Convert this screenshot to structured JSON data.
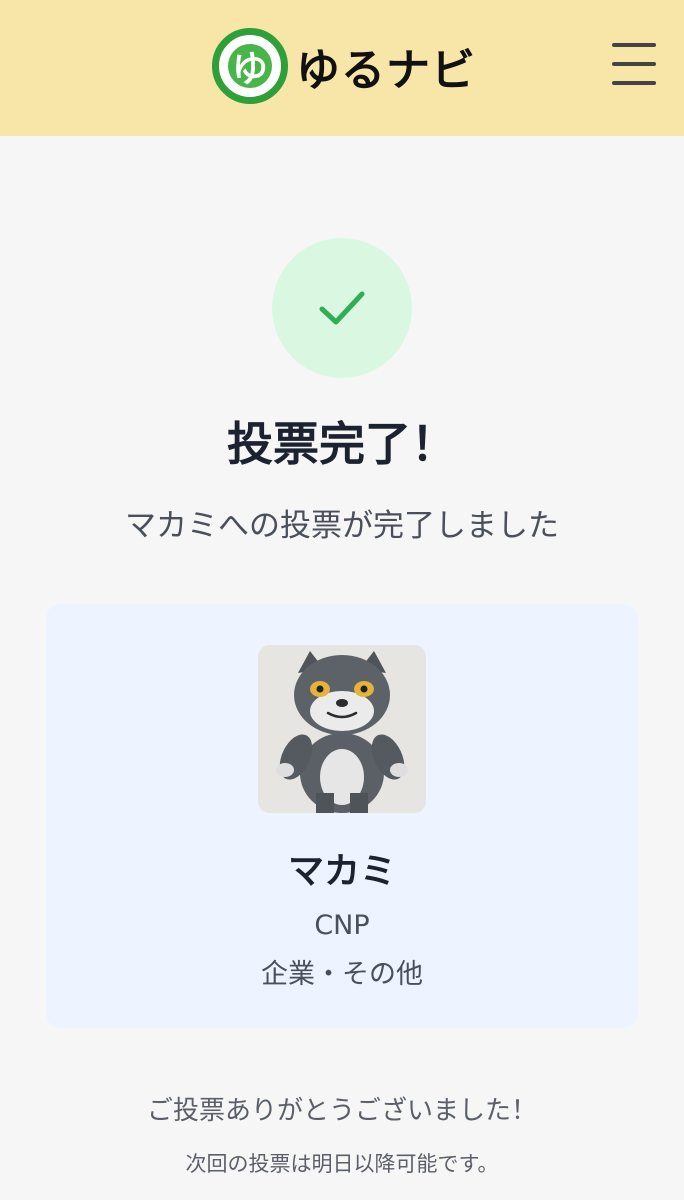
{
  "header": {
    "logo_mark": "ゆ",
    "logo_text": "ゆるナビ",
    "menu_icon": "hamburger-menu-icon",
    "background": "#f8e5a8"
  },
  "status": {
    "icon": "check-icon",
    "icon_color": "#2fae54",
    "circle_color": "#daf8e1",
    "title": "投票完了！",
    "message": "マカミへの投票が完了しました"
  },
  "character": {
    "image": "character-photo",
    "name": "マカミ",
    "organization": "CNP",
    "category": "企業・その他"
  },
  "footer": {
    "thanks": "ご投票ありがとうございました！",
    "next_vote": "次回の投票は明日以降可能です。"
  }
}
